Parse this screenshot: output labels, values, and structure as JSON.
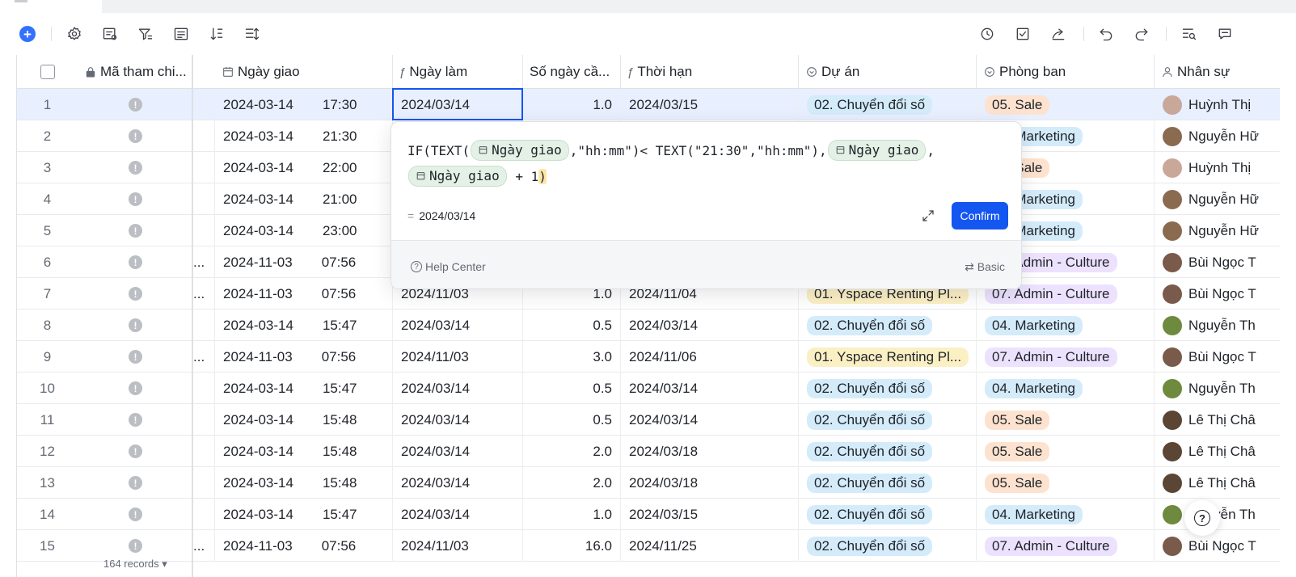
{
  "toolbar": {
    "left_icons": [
      "add-icon",
      "settings-icon",
      "field-settings-icon",
      "filter-icon",
      "group-icon",
      "sort-icon",
      "row-height-icon"
    ],
    "right_icons": [
      "history-icon",
      "checklist-icon",
      "share-icon",
      "undo-icon",
      "redo-icon",
      "search-records-icon",
      "comment-icon"
    ]
  },
  "columns": {
    "ref": "Mã tham chi...",
    "ngay_giao": "Ngày giao",
    "ngay_lam": "Ngày làm",
    "so_ngay": "Số ngày cầ...",
    "thoi_han": "Thời hạn",
    "du_an": "Dự án",
    "phong_ban": "Phòng ban",
    "nhan_su": "Nhân sự"
  },
  "rows": [
    {
      "n": "1",
      "dot": "!",
      "ref": "",
      "date": "2024-03-14",
      "time": "17:30",
      "lam": "2024/03/14",
      "so": "1.0",
      "han": "2024/03/15",
      "duan": "02. Chuyển đổi số",
      "pb": "05. Sale",
      "ns": "Huỳnh Thị"
    },
    {
      "n": "2",
      "dot": "!",
      "ref": "",
      "date": "2024-03-14",
      "time": "21:30",
      "lam": "",
      "so": "",
      "han": "",
      "duan": "",
      "pb": "04. Marketing",
      "ns": "Nguyễn Hữ"
    },
    {
      "n": "3",
      "dot": "!",
      "ref": "",
      "date": "2024-03-14",
      "time": "22:00",
      "lam": "",
      "so": "",
      "han": "",
      "duan": "",
      "pb": "05. Sale",
      "ns": "Huỳnh Thị"
    },
    {
      "n": "4",
      "dot": "!",
      "ref": "",
      "date": "2024-03-14",
      "time": "21:00",
      "lam": "",
      "so": "",
      "han": "",
      "duan": "",
      "pb": "04. Marketing",
      "ns": "Nguyễn Hữ"
    },
    {
      "n": "5",
      "dot": "!",
      "ref": "",
      "date": "2024-03-14",
      "time": "23:00",
      "lam": "",
      "so": "",
      "han": "",
      "duan": "",
      "pb": "04. Marketing",
      "ns": "Nguyễn Hữ"
    },
    {
      "n": "6",
      "dot": "!",
      "ref": "...",
      "date": "2024-11-03",
      "time": "07:56",
      "lam": "",
      "so": "",
      "han": "",
      "duan": "",
      "pb": "07. Admin - Culture",
      "ns": "Bùi Ngọc T"
    },
    {
      "n": "7",
      "dot": "!",
      "ref": "...",
      "date": "2024-11-03",
      "time": "07:56",
      "lam": "2024/11/03",
      "so": "1.0",
      "han": "2024/11/04",
      "duan": "01. Yspace Renting Pl...",
      "pb": "07. Admin - Culture",
      "ns": "Bùi Ngọc T"
    },
    {
      "n": "8",
      "dot": "!",
      "ref": "",
      "date": "2024-03-14",
      "time": "15:47",
      "lam": "2024/03/14",
      "so": "0.5",
      "han": "2024/03/14",
      "duan": "02. Chuyển đổi số",
      "pb": "04. Marketing",
      "ns": "Nguyễn Th"
    },
    {
      "n": "9",
      "dot": "!",
      "ref": "...",
      "date": "2024-11-03",
      "time": "07:56",
      "lam": "2024/11/03",
      "so": "3.0",
      "han": "2024/11/06",
      "duan": "01. Yspace Renting Pl...",
      "pb": "07. Admin - Culture",
      "ns": "Bùi Ngọc T"
    },
    {
      "n": "10",
      "dot": "!",
      "ref": "",
      "date": "2024-03-14",
      "time": "15:47",
      "lam": "2024/03/14",
      "so": "0.5",
      "han": "2024/03/14",
      "duan": "02. Chuyển đổi số",
      "pb": "04. Marketing",
      "ns": "Nguyễn Th"
    },
    {
      "n": "11",
      "dot": "!",
      "ref": "",
      "date": "2024-03-14",
      "time": "15:48",
      "lam": "2024/03/14",
      "so": "0.5",
      "han": "2024/03/14",
      "duan": "02. Chuyển đổi số",
      "pb": "05. Sale",
      "ns": "Lê Thị Châ"
    },
    {
      "n": "12",
      "dot": "!",
      "ref": "",
      "date": "2024-03-14",
      "time": "15:48",
      "lam": "2024/03/14",
      "so": "2.0",
      "han": "2024/03/18",
      "duan": "02. Chuyển đổi số",
      "pb": "05. Sale",
      "ns": "Lê Thị Châ"
    },
    {
      "n": "13",
      "dot": "!",
      "ref": "",
      "date": "2024-03-14",
      "time": "15:48",
      "lam": "2024/03/14",
      "so": "2.0",
      "han": "2024/03/18",
      "duan": "02. Chuyển đổi số",
      "pb": "05. Sale",
      "ns": "Lê Thị Châ"
    },
    {
      "n": "14",
      "dot": "!",
      "ref": "",
      "date": "2024-03-14",
      "time": "15:47",
      "lam": "2024/03/14",
      "so": "1.0",
      "han": "2024/03/15",
      "duan": "02. Chuyển đổi số",
      "pb": "04. Marketing",
      "ns": "Nguyễn Th"
    },
    {
      "n": "15",
      "dot": "!",
      "ref": "...",
      "date": "2024-11-03",
      "time": "07:56",
      "lam": "2024/11/03",
      "so": "16.0",
      "han": "2024/11/25",
      "duan": "02. Chuyển đổi số",
      "pb": "07. Admin - Culture",
      "ns": "Bùi Ngọc T"
    }
  ],
  "tag_colors": {
    "02. Chuyển đổi số": "#d4ebfa",
    "01. Yspace Renting Pl...": "#fbefc4",
    "05. Sale": "#fde3cf",
    "04. Marketing": "#d4ebfa",
    "07. Admin - Culture": "#ece2fe"
  },
  "formula_popup": {
    "if_open": "IF(",
    "text1": "TEXT(",
    "chip_label": "Ngày giao",
    "part2": ",\"hh:mm\")< TEXT(\"21:30\",\"hh:mm\"),",
    "comma": ",",
    "plus": " + 1",
    "close": ")",
    "eq": "=",
    "result": "2024/03/14",
    "confirm": "Confirm",
    "help": "Help Center",
    "basic": "⇄ Basic"
  },
  "footer": {
    "records": "164 records ▾"
  },
  "colors": {
    "accent": "#1456f0",
    "selected_row": "#e8effe"
  }
}
